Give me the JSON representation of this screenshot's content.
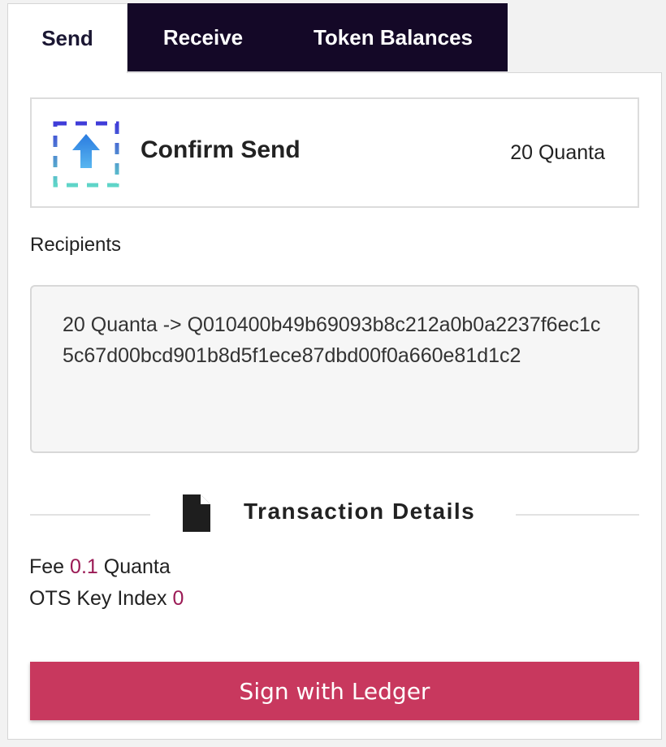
{
  "tabs": {
    "send": "Send",
    "receive": "Receive",
    "token_balances": "Token Balances",
    "active": "send"
  },
  "confirm": {
    "icon": "send-upload-icon",
    "title": "Confirm Send",
    "amount": "20 Quanta"
  },
  "recipients": {
    "label": "Recipients",
    "text": "20 Quanta -> Q010400b49b69093b8c212a0b0a2237f6ec1c5c67d00bcd901b8d5f1ece87dbd00f0a660e81d1c2"
  },
  "details": {
    "icon": "document-icon",
    "title": "Transaction Details",
    "fee_label": "Fee",
    "fee_value": "0.1",
    "fee_unit": "Quanta",
    "ots_label": "OTS Key Index",
    "ots_value": "0"
  },
  "actions": {
    "sign_label": "Sign with Ledger"
  },
  "colors": {
    "tab_dark": "#140827",
    "accent_value": "#9b1a55",
    "button": "#c8385e"
  }
}
